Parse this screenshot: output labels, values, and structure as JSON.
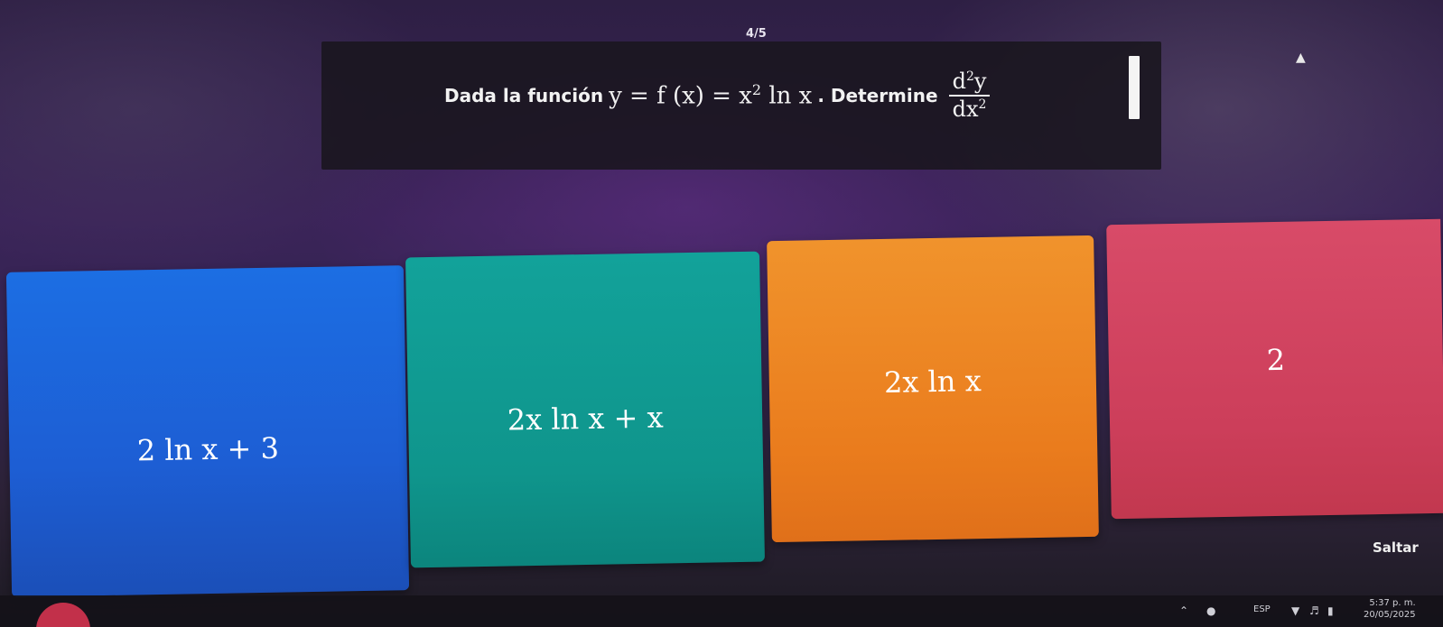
{
  "progress": "4/5",
  "question": {
    "prefix": "Dada la función",
    "equation": "y = f (x) = x",
    "exponent": "2",
    "log": " ln x",
    "suffix": ". Determine",
    "frac_num": "d",
    "frac_num_exp": "2",
    "frac_num_var": "y",
    "frac_den": "dx",
    "frac_den_exp": "2"
  },
  "answers": [
    {
      "label": "2 ln x + 3",
      "color": "#1d5ed4"
    },
    {
      "label": "2x ln x + x",
      "color": "#0f958c"
    },
    {
      "label": "2x ln x",
      "color": "#ea7c1d"
    },
    {
      "label": "2",
      "color": "#cc3e5a"
    }
  ],
  "skip_label": "Saltar",
  "tray": {
    "language": "ESP",
    "time": "5:37 p. m.",
    "date": "20/05/2025"
  }
}
